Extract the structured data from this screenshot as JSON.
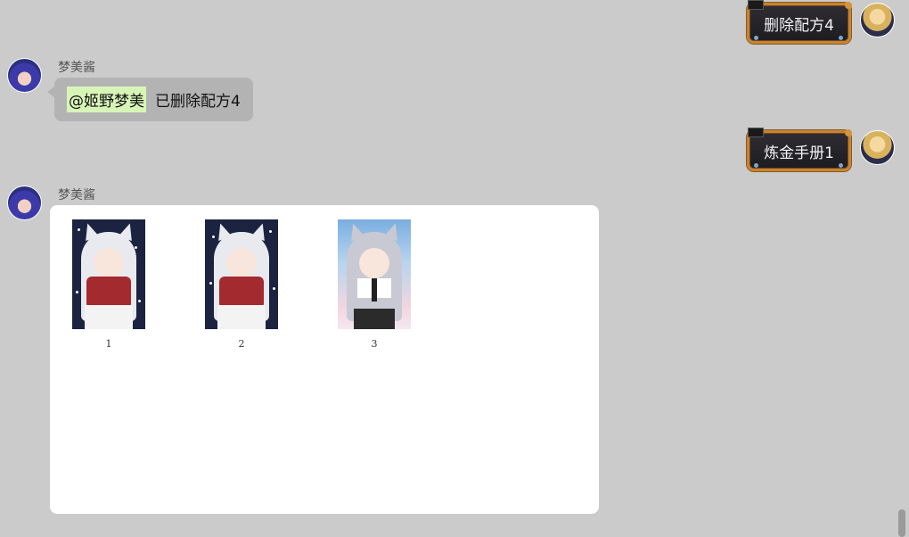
{
  "messages": [
    {
      "side": "self",
      "text": "删除配方4"
    },
    {
      "side": "bot",
      "name": "梦美酱",
      "mention": "@姬野梦美",
      "text": "已删除配方4"
    },
    {
      "side": "self",
      "text": "炼金手册1"
    },
    {
      "side": "bot",
      "name": "梦美酱",
      "images": [
        {
          "caption": "1"
        },
        {
          "caption": "2"
        },
        {
          "caption": "3"
        }
      ]
    }
  ],
  "colors": {
    "background": "#cbcbcb",
    "bot_bubble": "#b3b3b3",
    "self_bubble": "#242328",
    "self_border": "#c88330",
    "mention_bg": "#d8f5b8"
  }
}
